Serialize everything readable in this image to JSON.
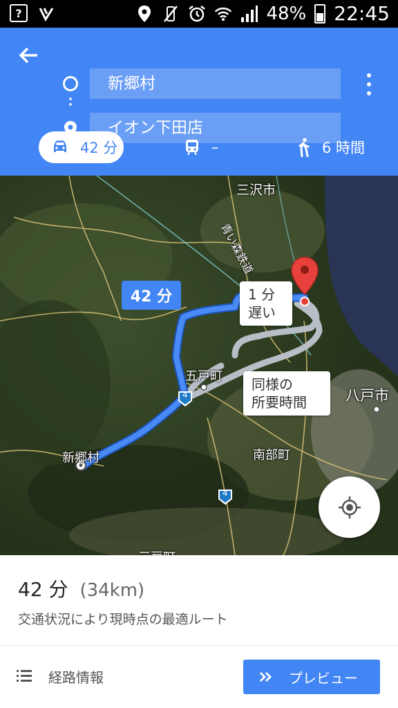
{
  "status_bar": {
    "battery": "48%",
    "time": "22:45",
    "icons": [
      "sim-card-icon",
      "app-notification-icon",
      "location-icon",
      "vibrate-mute-icon",
      "alarm-icon",
      "wifi-icon",
      "signal-icon",
      "battery-icon"
    ]
  },
  "header": {
    "origin": "新郷村",
    "destination": "イオン下田店",
    "modes": {
      "drive": "42 分",
      "transit": "–",
      "walk": "6 時間"
    },
    "accent": "#4285f4"
  },
  "map": {
    "route_badge": "42 分",
    "alt_route_1_line1": "1 分",
    "alt_route_1_line2": "遅い",
    "alt_route_2_line1": "同様の",
    "alt_route_2_line2": "所要時間",
    "places": {
      "misawa": "三沢市",
      "rail": "青い森鉄道",
      "gonohe": "五戸町",
      "hachinohe": "八戸市",
      "nanbu": "南部町",
      "shingo": "新郷村",
      "sannohe": "三戸町"
    },
    "route_shield": "4",
    "route_shield_2": "4",
    "route_color": "#4285f4",
    "alt_color": "#b8bec6",
    "pin_color": "#e8413c"
  },
  "summary": {
    "time": "42 分",
    "distance": "(34km)",
    "description": "交通状況により現時点の最適ルート",
    "steps_label": "経路情報",
    "preview_label": "プレビュー"
  }
}
